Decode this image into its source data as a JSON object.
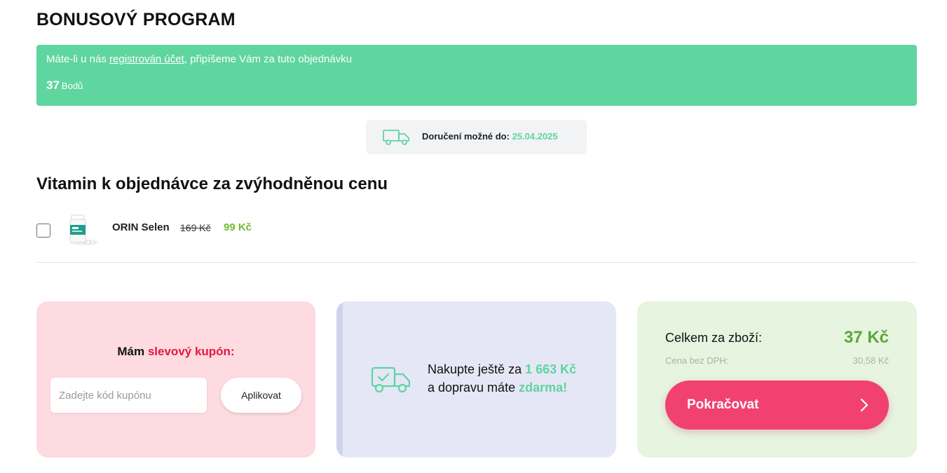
{
  "bonus": {
    "heading": "BONUSOVÝ PROGRAM",
    "text_before_link": "Máte-li u nás ",
    "link_text": "registrován účet",
    "text_after_link": ", připíšeme Vám za tuto objednávku",
    "points": "37",
    "points_unit": "Bodů"
  },
  "delivery": {
    "label": "Doručení možné do:",
    "date": "25.04.2025",
    "icon": "truck-icon"
  },
  "upsell": {
    "heading": "Vitamin k objednávce za zvýhodněnou cenu",
    "product": {
      "name": "ORIN Selen",
      "old_price": "169 Kč",
      "new_price": "99 Kč",
      "checked": false
    }
  },
  "coupon": {
    "title_prefix": "Mám ",
    "title_highlight": "slevový kupón:",
    "placeholder": "Zadejte kód kupónu",
    "apply_label": "Aplikovat"
  },
  "free_shipping": {
    "line1_prefix": "Nakupte ještě za ",
    "line1_amount": "1 663 Kč",
    "line2_prefix": "a dopravu máte ",
    "line2_highlight": "zdarma!",
    "icon": "truck-check-icon"
  },
  "summary": {
    "total_label": "Celkem za zboží:",
    "total_value": "37 Kč",
    "net_label": "Cena bez DPH:",
    "net_value": "30,58 Kč",
    "continue_label": "Pokračovat"
  },
  "colors": {
    "accent_green": "#5fd59f",
    "price_green": "#6dbb2f",
    "button_pink": "#f14170",
    "coupon_red": "#e5173f"
  }
}
